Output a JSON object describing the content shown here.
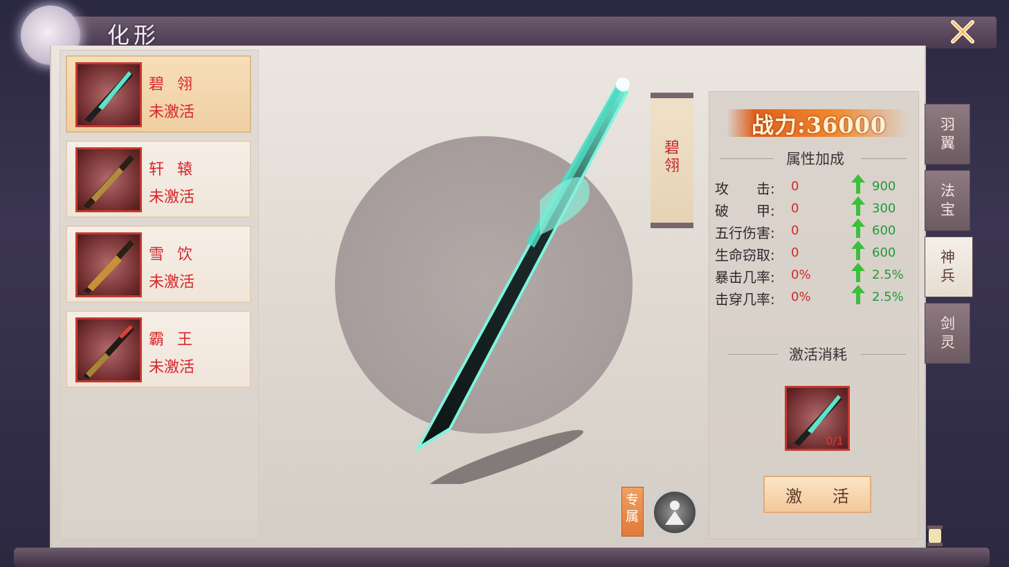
{
  "header": {
    "title": "化形"
  },
  "weapons": [
    {
      "name": "碧 翎",
      "status": "未激活",
      "selected": true
    },
    {
      "name": "轩 辕",
      "status": "未激活",
      "selected": false
    },
    {
      "name": "雪 饮",
      "status": "未激活",
      "selected": false
    },
    {
      "name": "霸 王",
      "status": "未激活",
      "selected": false
    }
  ],
  "preview": {
    "name": "碧翎",
    "exclusive_label": "专属"
  },
  "stats_panel": {
    "power": "战力:36000",
    "attribute_title": "属性加成",
    "stats": [
      {
        "label": "攻　　击:",
        "value": "0",
        "bonus": "900"
      },
      {
        "label": "破　　甲:",
        "value": "0",
        "bonus": "300"
      },
      {
        "label": "五行伤害:",
        "value": "0",
        "bonus": "600"
      },
      {
        "label": "生命窃取:",
        "value": "0",
        "bonus": "600"
      },
      {
        "label": "暴击几率:",
        "value": "0%",
        "bonus": "2.5%"
      },
      {
        "label": "击穿几率:",
        "value": "0%",
        "bonus": "2.5%"
      }
    ],
    "cost_title": "激活消耗",
    "cost_count": "0/1",
    "activate_label": "激 活"
  },
  "tabs": [
    {
      "label": "羽翼",
      "active": false
    },
    {
      "label": "法宝",
      "active": false
    },
    {
      "label": "神兵",
      "active": true
    },
    {
      "label": "剑灵",
      "active": false
    }
  ],
  "colors": {
    "accent_red": "#d8262a",
    "bonus_green": "#1f9a3a",
    "power_orange": "#e0601e"
  },
  "icons": [
    "close-icon",
    "moon-emblem-icon",
    "up-arrow-icon",
    "character-badge-icon",
    "lantern-icon"
  ]
}
